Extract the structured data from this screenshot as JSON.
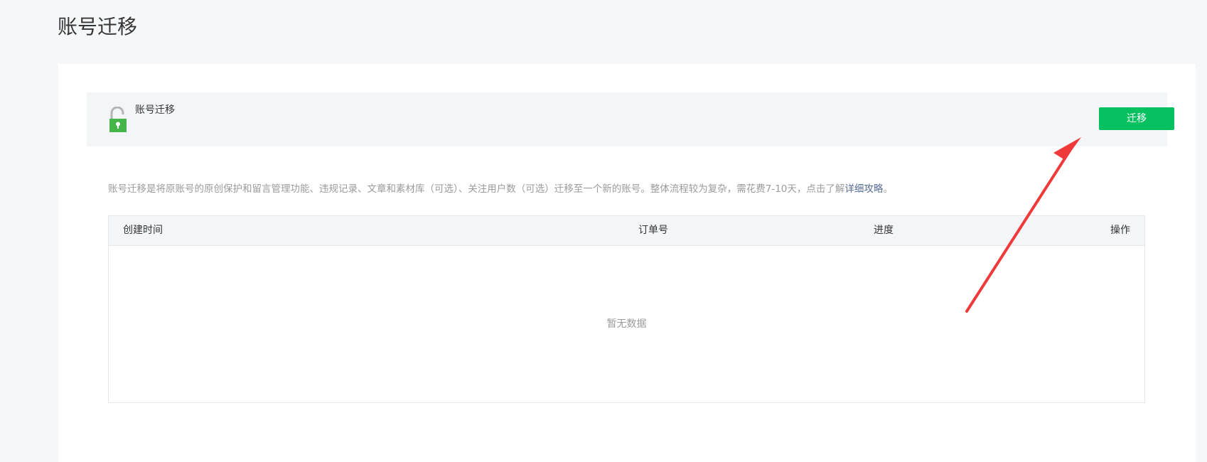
{
  "page": {
    "title": "账号迁移"
  },
  "banner": {
    "title": "账号迁移",
    "icon": "unlocked-padlock-icon",
    "button_label": "迁移",
    "button_color": "#07c160",
    "icon_color": "#44b549"
  },
  "description": {
    "text": "账号迁移是将原账号的原创保护和留言管理功能、违规记录、文章和素材库（可选）、关注用户数（可选）迁移至一个新的账号。整体流程较为复杂，需花费7-10天，点击了解",
    "link_text": "详细攻略",
    "suffix": "。",
    "link_color": "#576b95"
  },
  "table": {
    "columns": [
      "创建时间",
      "订单号",
      "进度",
      "操作"
    ],
    "rows": [],
    "empty_text": "暂无数据"
  },
  "annotation": {
    "arrow_color": "#f03a3a"
  }
}
